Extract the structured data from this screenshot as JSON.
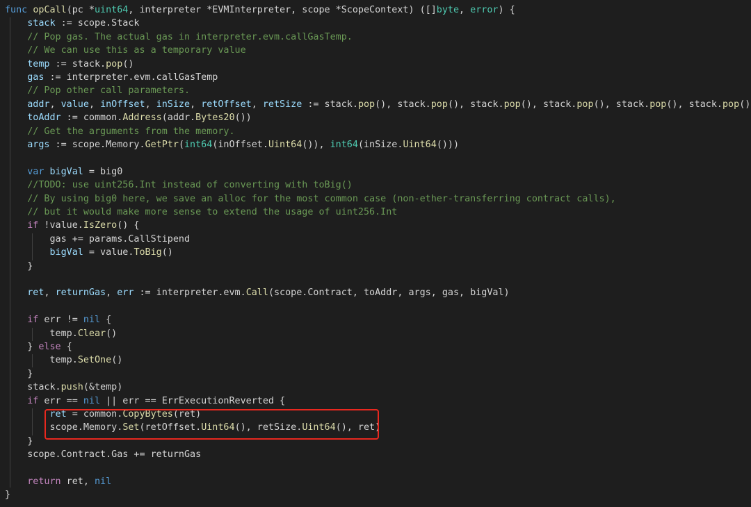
{
  "editor": {
    "language": "go",
    "theme_colors": {
      "background": "#1e1e1e",
      "keyword": "#569cd6",
      "control": "#c586c0",
      "function": "#dcdcaa",
      "type": "#4ec9b0",
      "variable": "#9cdcfe",
      "text": "#d4d4d4",
      "comment": "#6a9955",
      "number": "#b5cea8",
      "highlight_border": "#e8281f"
    },
    "highlighted_lines": [
      31,
      32
    ],
    "lines": [
      [
        [
          "kw",
          "func "
        ],
        [
          "fn",
          "opCall"
        ],
        [
          "txt",
          "(pc *"
        ],
        [
          "ty",
          "uint64"
        ],
        [
          "txt",
          ", interpreter *EVMInterpreter, scope *ScopeContext) ([]"
        ],
        [
          "ty",
          "byte"
        ],
        [
          "txt",
          ", "
        ],
        [
          "ty",
          "error"
        ],
        [
          "txt",
          ") {"
        ]
      ],
      [
        [
          "txt",
          "    "
        ],
        [
          "var",
          "stack"
        ],
        [
          "txt",
          " := scope.Stack"
        ]
      ],
      [
        [
          "com",
          "    // Pop gas. The actual gas in interpreter.evm.callGasTemp."
        ]
      ],
      [
        [
          "com",
          "    // We can use this as a temporary value"
        ]
      ],
      [
        [
          "txt",
          "    "
        ],
        [
          "var",
          "temp"
        ],
        [
          "txt",
          " := stack."
        ],
        [
          "fn",
          "pop"
        ],
        [
          "txt",
          "()"
        ]
      ],
      [
        [
          "txt",
          "    "
        ],
        [
          "var",
          "gas"
        ],
        [
          "txt",
          " := interpreter.evm.callGasTemp"
        ]
      ],
      [
        [
          "com",
          "    // Pop other call parameters."
        ]
      ],
      [
        [
          "txt",
          "    "
        ],
        [
          "var",
          "addr"
        ],
        [
          "txt",
          ", "
        ],
        [
          "var",
          "value"
        ],
        [
          "txt",
          ", "
        ],
        [
          "var",
          "inOffset"
        ],
        [
          "txt",
          ", "
        ],
        [
          "var",
          "inSize"
        ],
        [
          "txt",
          ", "
        ],
        [
          "var",
          "retOffset"
        ],
        [
          "txt",
          ", "
        ],
        [
          "var",
          "retSize"
        ],
        [
          "txt",
          " := stack."
        ],
        [
          "fn",
          "pop"
        ],
        [
          "txt",
          "(), stack."
        ],
        [
          "fn",
          "pop"
        ],
        [
          "txt",
          "(), stack."
        ],
        [
          "fn",
          "pop"
        ],
        [
          "txt",
          "(), stack."
        ],
        [
          "fn",
          "pop"
        ],
        [
          "txt",
          "(), stack."
        ],
        [
          "fn",
          "pop"
        ],
        [
          "txt",
          "(), stack."
        ],
        [
          "fn",
          "pop"
        ],
        [
          "txt",
          "()"
        ]
      ],
      [
        [
          "txt",
          "    "
        ],
        [
          "var",
          "toAddr"
        ],
        [
          "txt",
          " := common."
        ],
        [
          "fn",
          "Address"
        ],
        [
          "txt",
          "(addr."
        ],
        [
          "fn",
          "Bytes20"
        ],
        [
          "txt",
          "())"
        ]
      ],
      [
        [
          "com",
          "    // Get the arguments from the memory."
        ]
      ],
      [
        [
          "txt",
          "    "
        ],
        [
          "var",
          "args"
        ],
        [
          "txt",
          " := scope.Memory."
        ],
        [
          "fn",
          "GetPtr"
        ],
        [
          "txt",
          "("
        ],
        [
          "ty",
          "int64"
        ],
        [
          "txt",
          "(inOffset."
        ],
        [
          "fn",
          "Uint64"
        ],
        [
          "txt",
          "()), "
        ],
        [
          "ty",
          "int64"
        ],
        [
          "txt",
          "(inSize."
        ],
        [
          "fn",
          "Uint64"
        ],
        [
          "txt",
          "()))"
        ]
      ],
      [
        [
          "txt",
          " "
        ]
      ],
      [
        [
          "txt",
          "    "
        ],
        [
          "kw",
          "var "
        ],
        [
          "var",
          "bigVal"
        ],
        [
          "txt",
          " = big0"
        ]
      ],
      [
        [
          "com",
          "    //TODO: use uint256.Int instead of converting with toBig()"
        ]
      ],
      [
        [
          "com",
          "    // By using big0 here, we save an alloc for the most common case (non-ether-transferring contract calls),"
        ]
      ],
      [
        [
          "com",
          "    // but it would make more sense to extend the usage of uint256.Int"
        ]
      ],
      [
        [
          "txt",
          "    "
        ],
        [
          "ctl",
          "if"
        ],
        [
          "txt",
          " !value."
        ],
        [
          "fn",
          "IsZero"
        ],
        [
          "txt",
          "() {"
        ]
      ],
      [
        [
          "txt",
          "        gas += params.CallStipend"
        ]
      ],
      [
        [
          "txt",
          "        "
        ],
        [
          "var",
          "bigVal"
        ],
        [
          "txt",
          " = value."
        ],
        [
          "fn",
          "ToBig"
        ],
        [
          "txt",
          "()"
        ]
      ],
      [
        [
          "txt",
          "    }"
        ]
      ],
      [
        [
          "txt",
          " "
        ]
      ],
      [
        [
          "txt",
          "    "
        ],
        [
          "var",
          "ret"
        ],
        [
          "txt",
          ", "
        ],
        [
          "var",
          "returnGas"
        ],
        [
          "txt",
          ", "
        ],
        [
          "var",
          "err"
        ],
        [
          "txt",
          " := interpreter.evm."
        ],
        [
          "fn",
          "Call"
        ],
        [
          "txt",
          "(scope.Contract, toAddr, args, gas, bigVal)"
        ]
      ],
      [
        [
          "txt",
          " "
        ]
      ],
      [
        [
          "txt",
          "    "
        ],
        [
          "ctl",
          "if"
        ],
        [
          "txt",
          " err != "
        ],
        [
          "kw",
          "nil"
        ],
        [
          "txt",
          " {"
        ]
      ],
      [
        [
          "txt",
          "        temp."
        ],
        [
          "fn",
          "Clear"
        ],
        [
          "txt",
          "()"
        ]
      ],
      [
        [
          "txt",
          "    } "
        ],
        [
          "ctl",
          "else"
        ],
        [
          "txt",
          " {"
        ]
      ],
      [
        [
          "txt",
          "        temp."
        ],
        [
          "fn",
          "SetOne"
        ],
        [
          "txt",
          "()"
        ]
      ],
      [
        [
          "txt",
          "    }"
        ]
      ],
      [
        [
          "txt",
          "    stack."
        ],
        [
          "fn",
          "push"
        ],
        [
          "txt",
          "(&temp)"
        ]
      ],
      [
        [
          "txt",
          "    "
        ],
        [
          "ctl",
          "if"
        ],
        [
          "txt",
          " err == "
        ],
        [
          "kw",
          "nil"
        ],
        [
          "txt",
          " || err == ErrExecutionReverted {"
        ]
      ],
      [
        [
          "txt",
          "        "
        ],
        [
          "var",
          "ret"
        ],
        [
          "txt",
          " = common."
        ],
        [
          "fn",
          "CopyBytes"
        ],
        [
          "txt",
          "(ret)"
        ]
      ],
      [
        [
          "txt",
          "        scope.Memory."
        ],
        [
          "fn",
          "Set"
        ],
        [
          "txt",
          "(retOffset."
        ],
        [
          "fn",
          "Uint64"
        ],
        [
          "txt",
          "(), retSize."
        ],
        [
          "fn",
          "Uint64"
        ],
        [
          "txt",
          "(), ret)"
        ]
      ],
      [
        [
          "txt",
          "    }"
        ]
      ],
      [
        [
          "txt",
          "    scope.Contract.Gas += returnGas"
        ]
      ],
      [
        [
          "txt",
          " "
        ]
      ],
      [
        [
          "txt",
          "    "
        ],
        [
          "ctl",
          "return"
        ],
        [
          "txt",
          " ret, "
        ],
        [
          "kw",
          "nil"
        ]
      ],
      [
        [
          "txt",
          "}"
        ]
      ]
    ]
  }
}
